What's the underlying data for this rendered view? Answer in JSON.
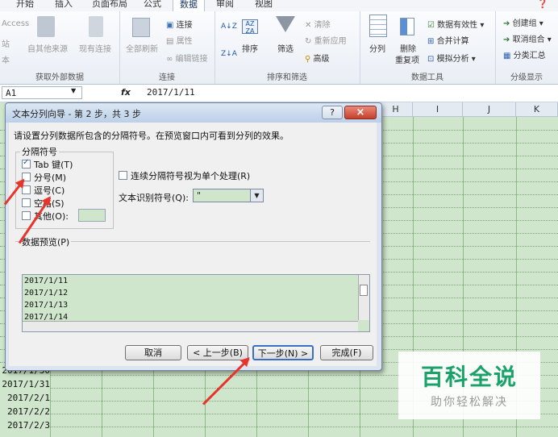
{
  "ribbon": {
    "tabs": [
      "开始",
      "插入",
      "页面布局",
      "公式",
      "数据",
      "审阅",
      "视图"
    ],
    "active_tab": "数据",
    "get_external": {
      "label": "获取外部数据",
      "items": [
        "Access",
        "站",
        "本",
        "自其他来源",
        "现有连接"
      ]
    },
    "connections": {
      "label": "连接",
      "refresh_all": "全部刷新",
      "connect": "连接",
      "properties": "属性",
      "edit_links": "编辑链接"
    },
    "sort_filter": {
      "label": "排序和筛选",
      "sort": "排序",
      "filter": "筛选",
      "clear": "清除",
      "reapply": "重新应用",
      "advanced": "高级"
    },
    "data_tools": {
      "label": "数据工具",
      "split": "分列",
      "remove_dup_1": "删除",
      "remove_dup_2": "重复项",
      "validation": "数据有效性",
      "consolidate": "合并计算",
      "whatif": "模拟分析"
    },
    "outline": {
      "label": "分级显示",
      "group": "创建组",
      "ungroup": "取消组合",
      "subtotal": "分类汇总"
    }
  },
  "formula_bar": {
    "name_box": "A1",
    "fx": "fx",
    "value": "2017/1/11"
  },
  "grid": {
    "columns": [
      "H",
      "I",
      "J",
      "K"
    ],
    "rows": [
      "2017/1/30",
      "2017/1/31",
      "2017/2/1",
      "2017/2/2",
      "2017/2/3"
    ]
  },
  "dialog": {
    "title": "文本分列向导 - 第 2 步，共 3 步",
    "help": "?",
    "close": "×",
    "instruction": "请设置分列数据所包含的分隔符号。在预览窗口内可看到分列的效果。",
    "delimiters_label": "分隔符号",
    "options": [
      {
        "label": "Tab 键(T)",
        "checked": true
      },
      {
        "label": "分号(M)",
        "checked": false
      },
      {
        "label": "逗号(C)",
        "checked": false
      },
      {
        "label": "空格(S)",
        "checked": false
      },
      {
        "label": "其他(O):",
        "checked": false
      }
    ],
    "consecutive": "连续分隔符号视为单个处理(R)",
    "qualifier_label": "文本识别符号(Q):",
    "qualifier_value": "\"",
    "preview_label": "数据预览(P)",
    "preview_rows": [
      "2017/1/11",
      "2017/1/12",
      "2017/1/13",
      "2017/1/14"
    ],
    "buttons": {
      "cancel": "取消",
      "back": "< 上一步(B)",
      "next": "下一步(N) >",
      "finish": "完成(F)"
    }
  },
  "watermark": {
    "title": "百科全说",
    "subtitle": "助你轻松解决"
  },
  "colors": {
    "accent": "#e8352c",
    "sheet_green": "#cfe6cc",
    "dialog_bg": "#f0f0f0",
    "watermark": "#1aa26a"
  }
}
